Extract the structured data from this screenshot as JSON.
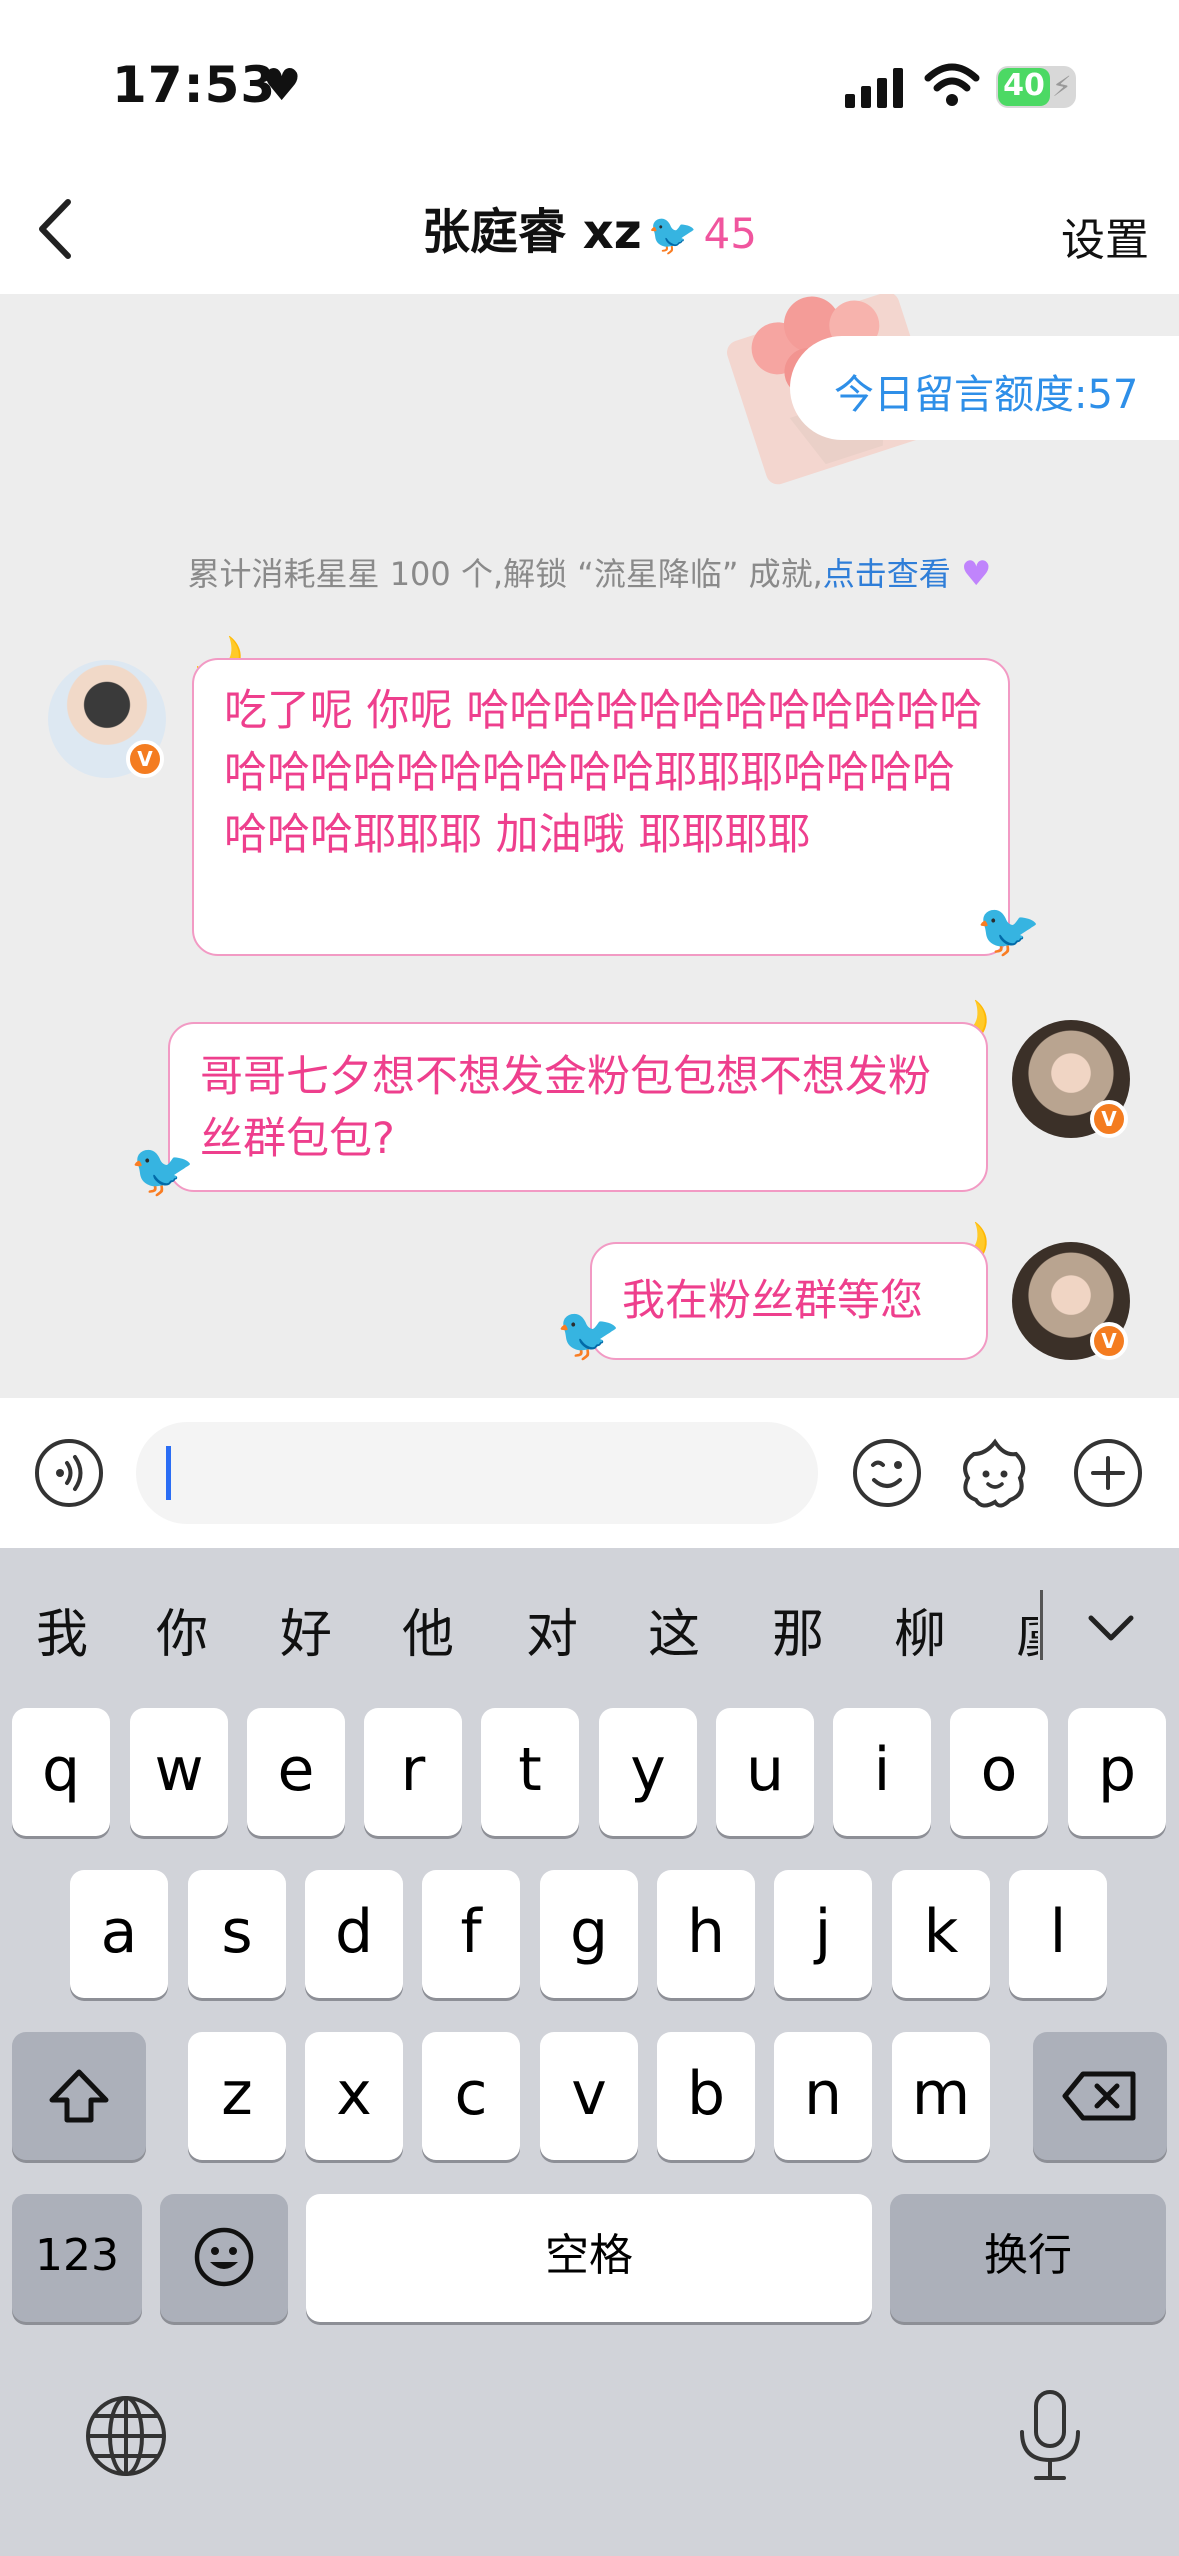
{
  "status_bar": {
    "time": "17:53",
    "battery": "40"
  },
  "header": {
    "title": "张庭睿 xz",
    "count": "45",
    "settings_label": "设置"
  },
  "chat": {
    "quota_label": "今日留言额度:57",
    "notice": {
      "text": "累计消耗星星 100 个,解锁 “流星降临” 成就,",
      "link": "点击查看"
    },
    "messages": [
      {
        "sender": "other",
        "text": "吃了呢 你呢  哈哈哈哈哈哈哈哈哈哈哈哈哈哈哈哈哈哈哈哈哈哈耶耶耶哈哈哈哈哈哈哈耶耶耶 加油哦 耶耶耶耶"
      },
      {
        "sender": "self",
        "text": "哥哥七夕想不想发金粉包包想不想发粉丝群包包?"
      },
      {
        "sender": "self",
        "text": "我在粉丝群等您"
      }
    ]
  },
  "input": {
    "placeholder": ""
  },
  "keyboard": {
    "candidates": [
      "我",
      "你",
      "好",
      "他",
      "对",
      "这",
      "那",
      "柳",
      "虞"
    ],
    "row1": [
      "q",
      "w",
      "e",
      "r",
      "t",
      "y",
      "u",
      "i",
      "o",
      "p"
    ],
    "row2": [
      "a",
      "s",
      "d",
      "f",
      "g",
      "h",
      "j",
      "k",
      "l"
    ],
    "row3": [
      "z",
      "x",
      "c",
      "v",
      "b",
      "n",
      "m"
    ],
    "numbers_label": "123",
    "space_label": "空格",
    "return_label": "换行"
  },
  "colors": {
    "accent_pink": "#ee3f8d",
    "link_blue": "#2f7ed8",
    "quota_blue": "#2e8fe8"
  }
}
